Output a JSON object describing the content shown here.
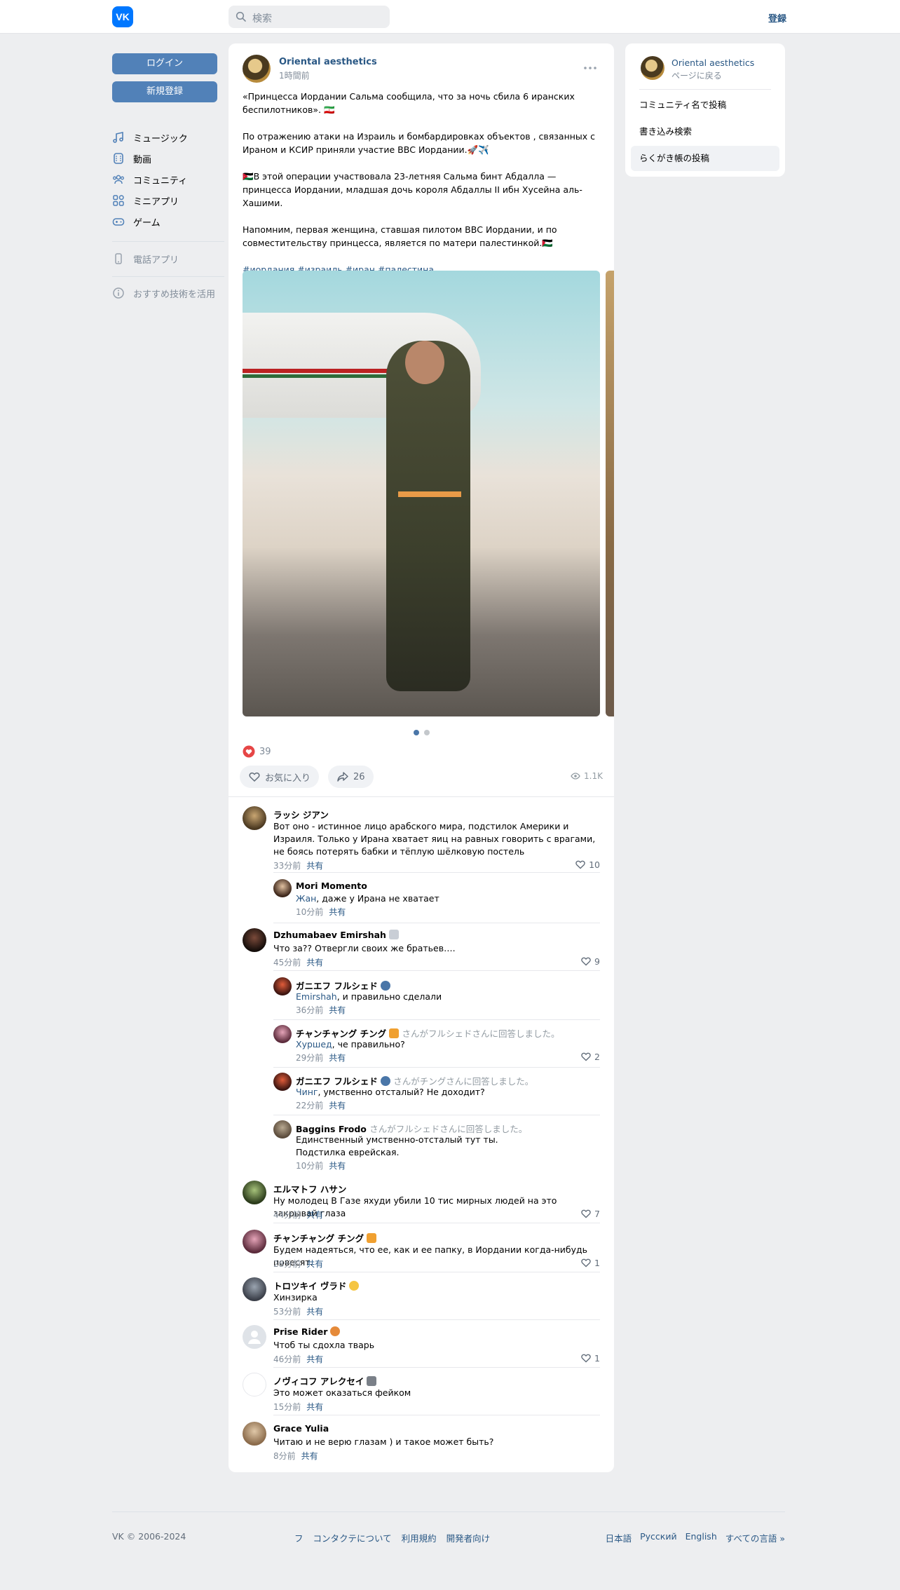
{
  "header": {
    "logo_text": "VK",
    "search_placeholder": "検索",
    "login": "登録"
  },
  "sidebar": {
    "login_button": "ログイン",
    "signup_button": "新規登録",
    "items": [
      {
        "label": "ミュージック",
        "icon": "music-icon"
      },
      {
        "label": "動画",
        "icon": "video-icon"
      },
      {
        "label": "コミュニティ",
        "icon": "community-icon"
      },
      {
        "label": "ミニアプリ",
        "icon": "mini-apps-icon"
      },
      {
        "label": "ゲーム",
        "icon": "games-icon"
      }
    ],
    "phone_apps": "電話アプリ",
    "recommend": "おすすめ技術を活用"
  },
  "post": {
    "author": "Oriental aesthetics",
    "time": "1時間前",
    "paragraphs": [
      "«Принцесса Иордании Сальма сообщила, что за ночь сбила 6 иранских беспилотников». 🇮🇷",
      "По отражению атаки на Израиль и бомбардировках объектов , связанных с Ираном и КСИР приняли участие ВВС Иордании.🚀✈️",
      "🇯🇴В этой операции участвовала 23-летняя Сальма бинт Абдалла — принцесса Иордании, младшая дочь короля Абдаллы II ибн Хусейна аль-Хашими.",
      "Напомним, первая женщина, ставшая пилотом ВВС Иордании, и по совместительству принцесса, является по матери палестинкой.🇵🇸"
    ],
    "hashtags": "#иордания #израиль #иран #палестина",
    "likes": "39",
    "like_button": "お気に入り",
    "shares": "26",
    "views": "1.1K"
  },
  "comments": [
    {
      "name": "ラッシ ジアン",
      "replied": "",
      "mention": "",
      "text": "Вот оно - истинное лицо арабского мира, подстилок Америки и Израиля. Только у Ирана хватает яиц на равных говорить с врагами, не боясь потерять бабки и тёплую шёлковую постель",
      "time": "33分前",
      "share": "共有",
      "likes": "10"
    },
    {
      "name": "Mori Momento",
      "replied": "",
      "mention": "Жан",
      "text": ", даже у Ирана не хватает",
      "time": "10分前",
      "share": "共有",
      "likes": ""
    },
    {
      "name": "Dzhumabaev Emirshah",
      "replied": "",
      "mention": "",
      "text": "Что за?? Отвергли своих же братьев….",
      "time": "45分前",
      "share": "共有",
      "likes": "9"
    },
    {
      "name": "ガニエフ フルシェド",
      "replied": "",
      "mention": "Emirshah",
      "text": ", и правильно сделали",
      "time": "36分前",
      "share": "共有",
      "likes": ""
    },
    {
      "name": "チャンチャング チング",
      "replied": "さんがフルシェドさんに回答しました。",
      "mention": "Хуршед",
      "text": ", че правильно?",
      "time": "29分前",
      "share": "共有",
      "likes": "2"
    },
    {
      "name": "ガニエフ フルシェド",
      "replied": "さんがチングさんに回答しました。",
      "mention": "Чинг",
      "text": ", умственно отсталый? Не доходит?",
      "time": "22分前",
      "share": "共有",
      "likes": ""
    },
    {
      "name": "Baggins Frodo",
      "replied": "さんがフルシェドさんに回答しました。",
      "mention": "",
      "text": "Единственный умственно-отсталый тут ты.\nПодстилка еврейская.",
      "time": "10分前",
      "share": "共有",
      "likes": ""
    },
    {
      "name": "エルマトフ ハサン",
      "replied": "",
      "mention": "",
      "text": "Ну молодец В Газе яхуди убили 10 тис мирных людей на это закрывай глаза",
      "time": "44分前",
      "share": "共有",
      "likes": "7"
    },
    {
      "name": "チャンチャング チング",
      "replied": "",
      "mention": "",
      "text": "Будем надеяться, что ее, как и ее папку, в Иордании когда-нибудь повесят.",
      "time": "28分前",
      "share": "共有",
      "likes": "1"
    },
    {
      "name": "トロツキイ ヴラド",
      "replied": "",
      "mention": "",
      "text": "Хинзирка",
      "time": "53分前",
      "share": "共有",
      "likes": ""
    },
    {
      "name": "Prise Rider",
      "replied": "",
      "mention": "",
      "text": "Чтоб ты сдохла тварь",
      "time": "46分前",
      "share": "共有",
      "likes": "1"
    },
    {
      "name": "ノヴィコフ アレクセイ",
      "replied": "",
      "mention": "",
      "text": "Это может оказаться фейком",
      "time": "15分前",
      "share": "共有",
      "likes": ""
    },
    {
      "name": "Grace Yulia",
      "replied": "",
      "mention": "",
      "text": "Читаю и не верю глазам ) и такое может быть?",
      "time": "8分前",
      "share": "共有",
      "likes": ""
    }
  ],
  "right_panel": {
    "community": "Oriental aesthetics",
    "back": "ページに戻る",
    "items": [
      "コミュニティ名で投稿",
      "書き込み検索",
      "らくがき帳の投稿"
    ]
  },
  "footer": {
    "copyright": "VK © 2006-2024",
    "links": [
      "フ",
      "コンタクテについて",
      "利用規約",
      "開発者向け"
    ],
    "languages": [
      "日本語",
      "Русский",
      "English",
      "すべての言語 »"
    ]
  },
  "colors": {
    "accent": "#5181b8",
    "link": "#2a5885",
    "background": "#edeef0",
    "like_red": "#e64646"
  }
}
